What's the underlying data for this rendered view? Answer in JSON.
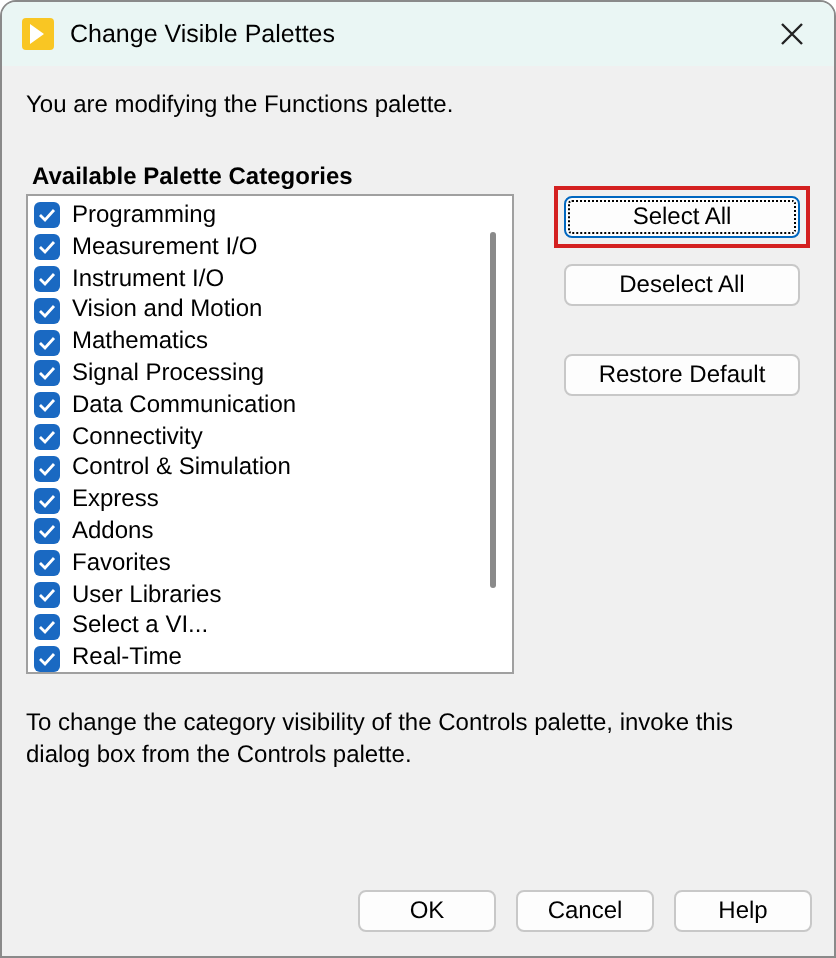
{
  "window": {
    "title": "Change Visible Palettes"
  },
  "intro": "You are modifying the Functions palette.",
  "categories": {
    "heading": "Available Palette Categories",
    "items": [
      {
        "label": "Programming",
        "checked": true
      },
      {
        "label": "Measurement I/O",
        "checked": true
      },
      {
        "label": "Instrument I/O",
        "checked": true
      },
      {
        "label": "Vision and Motion",
        "checked": true
      },
      {
        "label": "Mathematics",
        "checked": true
      },
      {
        "label": "Signal Processing",
        "checked": true
      },
      {
        "label": "Data Communication",
        "checked": true
      },
      {
        "label": "Connectivity",
        "checked": true
      },
      {
        "label": "Control & Simulation",
        "checked": true
      },
      {
        "label": "Express",
        "checked": true
      },
      {
        "label": "Addons",
        "checked": true
      },
      {
        "label": "Favorites",
        "checked": true
      },
      {
        "label": "User Libraries",
        "checked": true
      },
      {
        "label": "Select a VI...",
        "checked": true
      },
      {
        "label": "Real-Time",
        "checked": true
      }
    ]
  },
  "side_buttons": [
    {
      "label": "Select All",
      "focused": true,
      "highlighted": true
    },
    {
      "label": "Deselect All",
      "focused": false,
      "highlighted": false
    },
    {
      "label": "Restore Default",
      "focused": false,
      "highlighted": false
    }
  ],
  "note": "To change the category visibility of the Controls palette, invoke this dialog box from the Controls palette.",
  "buttons": [
    "OK",
    "Cancel",
    "Help"
  ]
}
